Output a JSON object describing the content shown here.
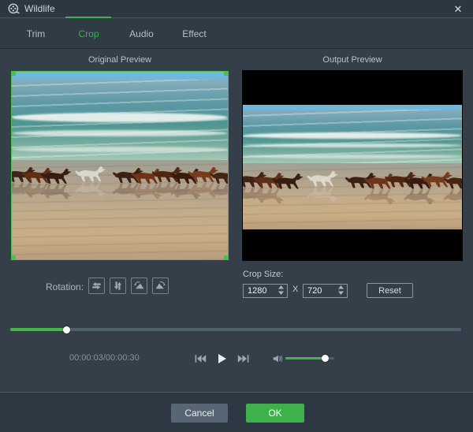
{
  "window": {
    "title": "Wildlife",
    "close_icon": "✕"
  },
  "tabs": [
    {
      "label": "Trim",
      "active": false
    },
    {
      "label": "Crop",
      "active": true
    },
    {
      "label": "Audio",
      "active": false
    },
    {
      "label": "Effect",
      "active": false
    }
  ],
  "previews": {
    "original_label": "Original Preview",
    "output_label": "Output Preview"
  },
  "rotation": {
    "label": "Rotation:",
    "buttons": [
      "flip-horizontal",
      "flip-vertical",
      "rotate-left",
      "rotate-right"
    ]
  },
  "crop_size": {
    "label": "Crop Size:",
    "width_value": "1280",
    "separator": "X",
    "height_value": "720",
    "reset_label": "Reset"
  },
  "timeline": {
    "progress_percent": 12.5
  },
  "transport": {
    "time_text": "00:00:03/00:00:30"
  },
  "volume": {
    "level_percent": 82
  },
  "footer": {
    "cancel_label": "Cancel",
    "ok_label": "OK"
  },
  "icons": {
    "app": "film-reel",
    "close": "close-x",
    "transport": [
      "skip-back",
      "play",
      "skip-forward"
    ],
    "volume": "speaker"
  },
  "colors": {
    "accent_green": "#3cb34a",
    "slider_green": "#44b549",
    "crop_handle_green": "#4ac14e",
    "titlebar_bg": "#2d3742",
    "content_bg": "#353f49",
    "footer_bg": "#2e3842",
    "ok_button": "#3eb14a",
    "cancel_button": "#576675"
  }
}
